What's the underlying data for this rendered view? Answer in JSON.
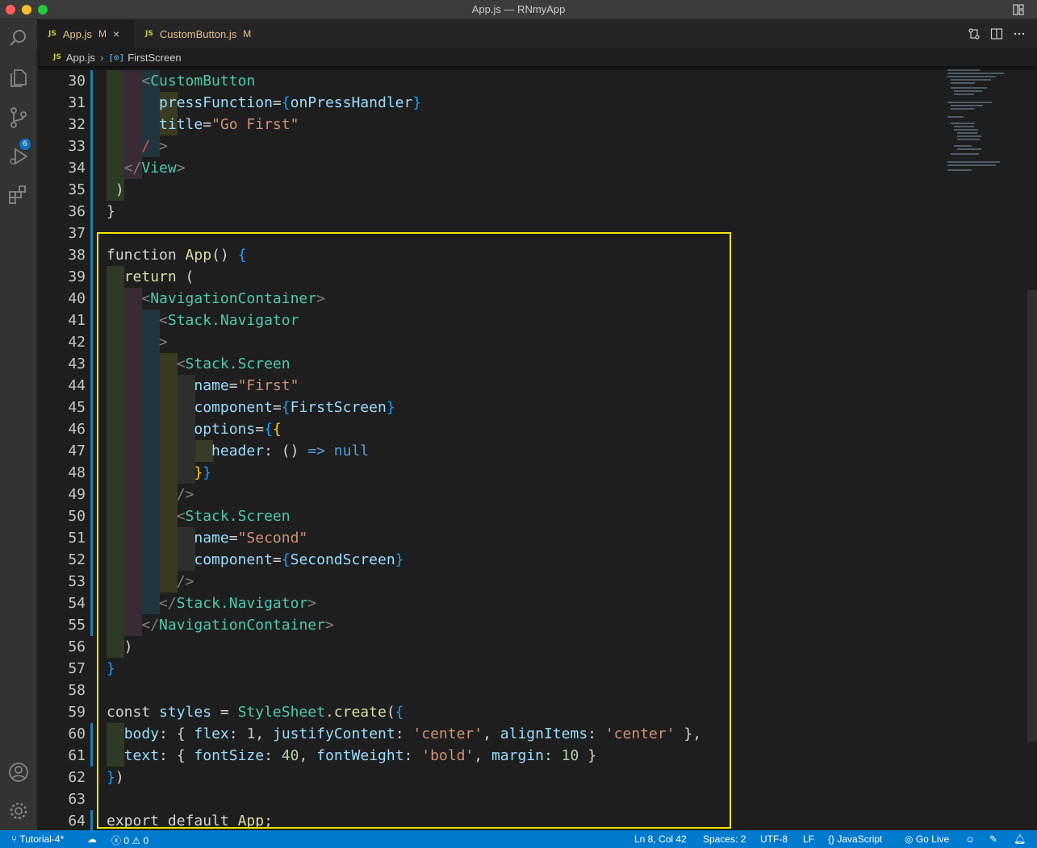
{
  "window": {
    "title": "App.js — RNmyApp"
  },
  "activity": {
    "scm_badge": "6"
  },
  "tabs": [
    {
      "lang": "JS",
      "label": "App.js",
      "status": "M",
      "close": "×"
    },
    {
      "lang": "JS",
      "label": "CustomButton.js",
      "status": "M"
    }
  ],
  "breadcrumb": {
    "lang": "JS",
    "file": "App.js",
    "symbol": "FirstScreen"
  },
  "editor": {
    "line_numbers": [
      "30",
      "31",
      "32",
      "33",
      "34",
      "35",
      "36",
      "37",
      "38",
      "39",
      "40",
      "41",
      "42",
      "43",
      "44",
      "45",
      "46",
      "47",
      "48",
      "49",
      "50",
      "51",
      "52",
      "53",
      "54",
      "55",
      "56",
      "57",
      "58",
      "59",
      "60",
      "61",
      "62",
      "63",
      "64"
    ]
  },
  "statusbar": {
    "branch": "Tutorial-4*",
    "errors": "0",
    "warnings": "0",
    "position": "Ln 8, Col 42",
    "spaces": "Spaces: 2",
    "encoding": "UTF-8",
    "eol": "LF",
    "language": "JavaScript",
    "golive": "Go Live"
  },
  "colors": {
    "statusbar": "#007acc",
    "highlight_box": "#f2e600",
    "tag": "#4ec9b0",
    "attribute": "#9cdcfe",
    "string": "#ce9178"
  }
}
